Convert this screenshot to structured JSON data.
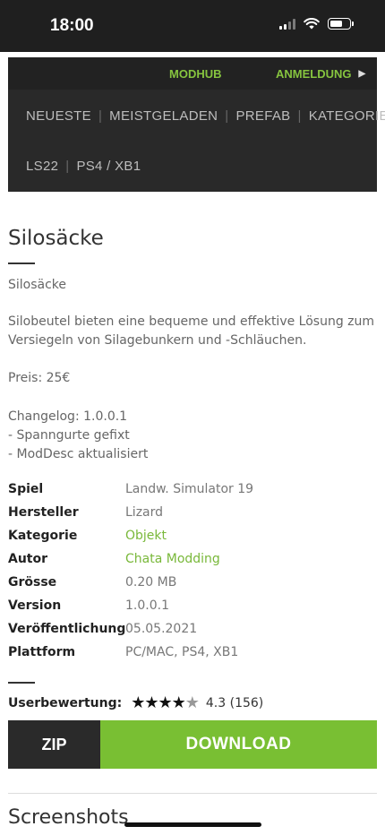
{
  "status_bar": {
    "time": "18:00",
    "icons": [
      "signal-icon",
      "wifi-icon",
      "battery-icon"
    ]
  },
  "nav": {
    "modhub": "MODHUB",
    "login": "ANMELDUNG",
    "row1": [
      "NEUESTE",
      "MEISTGELADEN",
      "PREFAB",
      "KATEGORIE"
    ],
    "row2": [
      "LS22",
      "PS4 / XB1"
    ]
  },
  "mod": {
    "title": "Silosäcke",
    "subtitle": "Silosäcke",
    "description": "Silobeutel bieten eine bequeme und effektive Lösung zum Versiegeln von Silagebunkern und -Schläuchen.",
    "price": "Preis: 25€",
    "changelog": [
      "Changelog: 1.0.0.1",
      "- Spanngurte gefixt",
      "- ModDesc aktualisiert"
    ]
  },
  "specs": [
    {
      "key": "Spiel",
      "value": "Landw. Simulator 19"
    },
    {
      "key": "Hersteller",
      "value": "Lizard"
    },
    {
      "key": "Kategorie",
      "value": "Objekt"
    },
    {
      "key": "Autor",
      "value": "Chata Modding"
    },
    {
      "key": "Grösse",
      "value": "0.20 MB"
    },
    {
      "key": "Version",
      "value": "1.0.0.1"
    },
    {
      "key": "Veröffentlichung",
      "value": "05.05.2021"
    },
    {
      "key": "Plattform",
      "value": "PC/MAC, PS4, XB1"
    }
  ],
  "rating": {
    "label": "Userbewertung:",
    "score_text": "4.3 (156)",
    "value": 4.3,
    "max": 5
  },
  "buttons": {
    "zip": "ZIP",
    "download": "DOWNLOAD"
  },
  "screenshots_heading": "Screenshots",
  "colors": {
    "accent_green": "#79bf33",
    "nav_bg": "#292929",
    "link_green": "#79b83a"
  }
}
